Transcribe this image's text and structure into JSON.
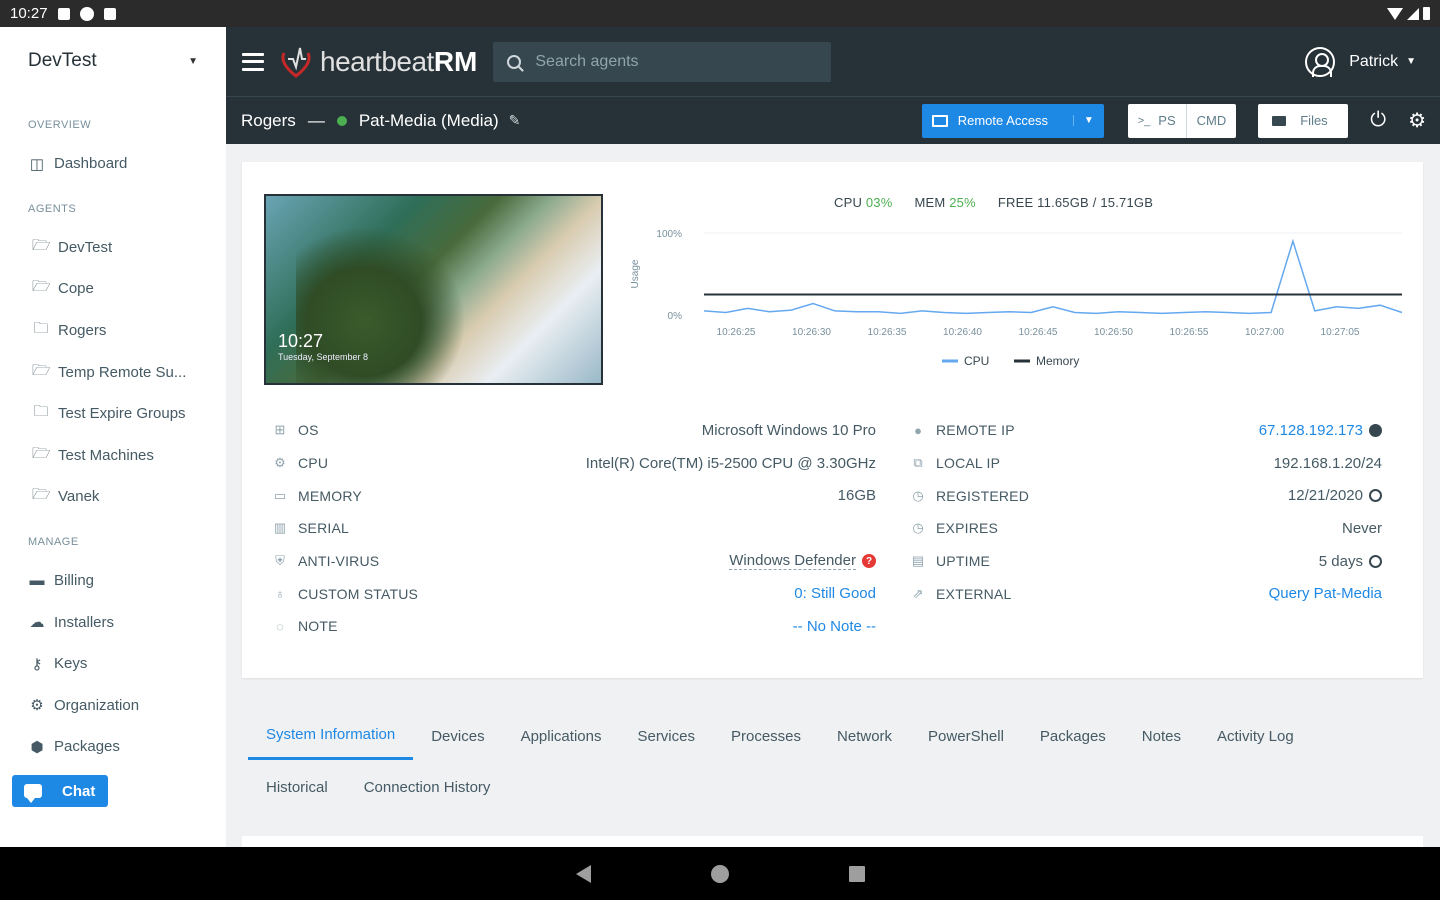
{
  "statusbar": {
    "time": "10:27"
  },
  "sidebar": {
    "org": "DevTest",
    "sections": {
      "overview": "OVERVIEW",
      "agents": "AGENTS",
      "manage": "MANAGE"
    },
    "overview_items": [
      {
        "label": "Dashboard",
        "icon": "dashboard-icon"
      }
    ],
    "agent_items": [
      {
        "label": "DevTest",
        "icon": "folder-open-icon"
      },
      {
        "label": "Cope",
        "icon": "folder-open-icon"
      },
      {
        "label": "Rogers",
        "icon": "folder-icon"
      },
      {
        "label": "Temp Remote Su...",
        "icon": "folder-open-icon"
      },
      {
        "label": "Test Expire Groups",
        "icon": "folder-icon"
      },
      {
        "label": "Test Machines",
        "icon": "folder-open-icon"
      },
      {
        "label": "Vanek",
        "icon": "folder-open-icon"
      }
    ],
    "manage_items": [
      {
        "label": "Billing",
        "icon": "credit-card-icon"
      },
      {
        "label": "Installers",
        "icon": "cloud-download-icon"
      },
      {
        "label": "Keys",
        "icon": "key-icon"
      },
      {
        "label": "Organization",
        "icon": "gear-icon"
      },
      {
        "label": "Packages",
        "icon": "package-icon"
      }
    ],
    "chat_label": "Chat"
  },
  "topbar": {
    "logo_thin": "heartbeat",
    "logo_bold": "RM",
    "search_placeholder": "Search agents",
    "user": "Patrick"
  },
  "subbar": {
    "group": "Rogers",
    "separator": "—",
    "agent": "Pat-Media (Media)",
    "remote_access": "Remote Access",
    "ps_prefix": ">_",
    "ps": "PS",
    "cmd": "CMD",
    "files": "Files"
  },
  "thumbnail": {
    "time": "10:27",
    "date": "Tuesday, September 8"
  },
  "stats": {
    "cpu_label": "CPU",
    "cpu_value": "03%",
    "mem_label": "MEM",
    "mem_value": "25%",
    "free_label": "FREE",
    "free_value": "11.65GB / 15.71GB"
  },
  "chart_data": {
    "type": "line",
    "ylabel": "Usage",
    "ylim": [
      0,
      100
    ],
    "y_ticks": [
      "100%",
      "0%"
    ],
    "x": [
      "10:26:25",
      "10:26:30",
      "10:26:35",
      "10:26:40",
      "10:26:45",
      "10:26:50",
      "10:26:55",
      "10:27:00",
      "10:27:05"
    ],
    "series": [
      {
        "name": "CPU",
        "color": "#64a8f0",
        "values": [
          5,
          3,
          8,
          4,
          6,
          14,
          5,
          4,
          4,
          2,
          5,
          3,
          2,
          3,
          4,
          3,
          10,
          3,
          2,
          4,
          3,
          2,
          3,
          4,
          3,
          2,
          3,
          90,
          5,
          10,
          8,
          12,
          3
        ]
      },
      {
        "name": "Memory",
        "color": "#263238",
        "values": [
          25,
          25,
          25,
          25,
          25,
          25,
          25,
          25,
          25,
          25,
          25,
          25,
          25,
          25,
          25,
          25,
          25,
          25,
          25,
          25,
          25,
          25,
          25,
          25,
          25,
          25,
          25,
          25,
          25,
          25,
          25,
          25,
          25
        ]
      }
    ],
    "legend": "bottom"
  },
  "info_left": [
    {
      "icon": "windows-icon",
      "label": "OS",
      "value": "Microsoft Windows 10 Pro"
    },
    {
      "icon": "cpu-icon",
      "label": "CPU",
      "value": "Intel(R) Core(TM) i5-2500 CPU @ 3.30GHz"
    },
    {
      "icon": "memory-icon",
      "label": "MEMORY",
      "value": "16GB"
    },
    {
      "icon": "barcode-icon",
      "label": "SERIAL",
      "value": ""
    },
    {
      "icon": "shield-icon",
      "label": "ANTI-VIRUS",
      "value": "Windows Defender"
    },
    {
      "icon": "lightbulb-icon",
      "label": "CUSTOM STATUS",
      "value": "0: Still Good"
    },
    {
      "icon": "comment-icon",
      "label": "NOTE",
      "value": "-- No Note --"
    }
  ],
  "info_right": [
    {
      "icon": "globe-icon",
      "label": "REMOTE IP",
      "value": "67.128.192.173"
    },
    {
      "icon": "network-icon",
      "label": "LOCAL IP",
      "value": "192.168.1.20/24"
    },
    {
      "icon": "clock-icon",
      "label": "REGISTERED",
      "value": "12/21/2020"
    },
    {
      "icon": "clock-icon",
      "label": "EXPIRES",
      "value": "Never"
    },
    {
      "icon": "server-icon",
      "label": "UPTIME",
      "value": "5 days"
    },
    {
      "icon": "external-link-icon",
      "label": "EXTERNAL",
      "value": "Query Pat-Media"
    }
  ],
  "tabs": [
    "System Information",
    "Devices",
    "Applications",
    "Services",
    "Processes",
    "Network",
    "PowerShell",
    "Packages",
    "Notes",
    "Activity Log"
  ],
  "subtabs": [
    "Historical",
    "Connection History"
  ]
}
